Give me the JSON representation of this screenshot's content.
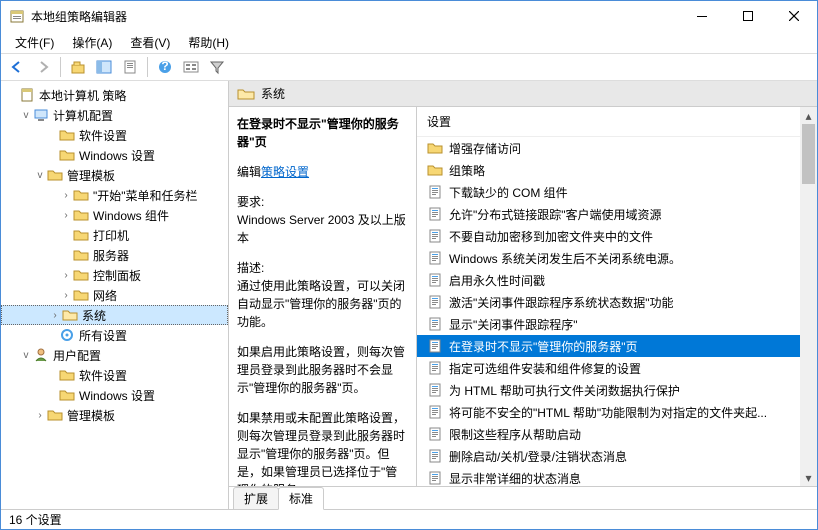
{
  "window": {
    "title": "本地组策略编辑器"
  },
  "menu": {
    "file": "文件(F)",
    "action": "操作(A)",
    "view": "查看(V)",
    "help": "帮助(H)"
  },
  "tree": {
    "root": "本地计算机 策略",
    "computer": "计算机配置",
    "c_soft": "软件设置",
    "c_win": "Windows 设置",
    "c_admin": "管理模板",
    "c_start": "\"开始\"菜单和任务栏",
    "c_wincomp": "Windows 组件",
    "c_printer": "打印机",
    "c_server": "服务器",
    "c_ctrl": "控制面板",
    "c_network": "网络",
    "c_system": "系统",
    "c_all": "所有设置",
    "user": "用户配置",
    "u_soft": "软件设置",
    "u_win": "Windows 设置",
    "u_admin": "管理模板"
  },
  "content": {
    "header": "系统",
    "desc_title": "在登录时不显示\"管理你的服务器\"页",
    "edit_prefix": "编辑",
    "edit_link": "策略设置",
    "req_label": "要求:",
    "req_text": "Windows Server 2003 及以上版本",
    "desc_label": "描述:",
    "desc_p1": "通过使用此策略设置，可以关闭自动显示\"管理你的服务器\"页的功能。",
    "desc_p2": "如果启用此策略设置，则每次管理员登录到此服务器时不会显示\"管理你的服务器\"页。",
    "desc_p3": "如果禁用或未配置此策略设置，则每次管理员登录到此服务器时显示\"管理你的服务器\"页。但是，如果管理员已选择位于\"管理你的服务"
  },
  "list": {
    "header": "设置",
    "items": [
      {
        "label": "增强存储访问",
        "type": "folder"
      },
      {
        "label": "组策略",
        "type": "folder"
      },
      {
        "label": "下载缺少的 COM 组件",
        "type": "setting"
      },
      {
        "label": "允许\"分布式链接跟踪\"客户端使用域资源",
        "type": "setting"
      },
      {
        "label": "不要自动加密移到加密文件夹中的文件",
        "type": "setting"
      },
      {
        "label": "Windows 系统关闭发生后不关闭系统电源。",
        "type": "setting"
      },
      {
        "label": "启用永久性时间戳",
        "type": "setting"
      },
      {
        "label": "激活\"关闭事件跟踪程序系统状态数据\"功能",
        "type": "setting"
      },
      {
        "label": "显示\"关闭事件跟踪程序\"",
        "type": "setting"
      },
      {
        "label": "在登录时不显示\"管理你的服务器\"页",
        "type": "setting",
        "selected": true
      },
      {
        "label": "指定可选组件安装和组件修复的设置",
        "type": "setting"
      },
      {
        "label": "为 HTML 帮助可执行文件关闭数据执行保护",
        "type": "setting"
      },
      {
        "label": "将可能不安全的\"HTML 帮助\"功能限制为对指定的文件夹起...",
        "type": "setting"
      },
      {
        "label": "限制这些程序从帮助启动",
        "type": "setting"
      },
      {
        "label": "删除启动/关机/登录/注销状态消息",
        "type": "setting"
      },
      {
        "label": "显示非常详细的状态消息",
        "type": "setting"
      }
    ]
  },
  "tabs": {
    "extended": "扩展",
    "standard": "标准"
  },
  "status": "16 个设置"
}
